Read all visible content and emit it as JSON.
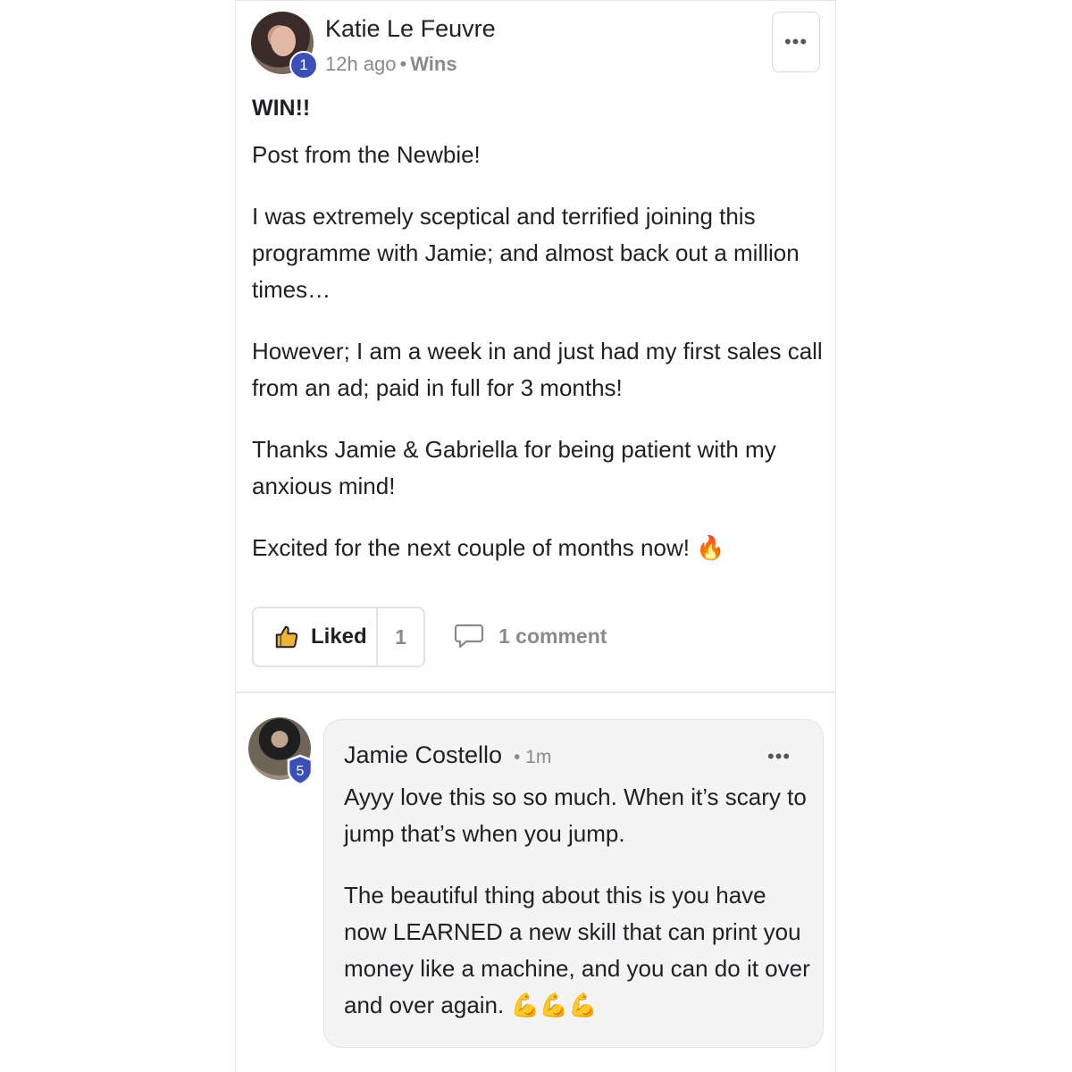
{
  "post": {
    "author": "Katie Le Feuvre",
    "level": "1",
    "time": "12h ago",
    "separator": "•",
    "category": "Wins",
    "more": "•••",
    "title": "WIN!!",
    "paragraphs": [
      "Post from the Newbie!",
      "I was extremely sceptical and terrified joining this programme with Jamie; and almost back out a million times…",
      "However; I am a week in and just had my first sales call from an ad; paid in full for 3 months!",
      "Thanks Jamie & Gabriella for being patient with my anxious mind!",
      "Excited for the next couple of months now!"
    ],
    "last_emoji": "🔥",
    "like_label": "Liked",
    "like_count": "1",
    "comment_label": "1 comment"
  },
  "comment": {
    "author": "Jamie Costello",
    "level": "5",
    "time": "• 1m",
    "more": "•••",
    "paragraphs": [
      "Ayyy love this so so much. When it’s scary to jump that’s when you jump.",
      "The beautiful thing about this is you have now LEARNED a new skill that can print you money like a machine, and you can do it over and over again."
    ],
    "last_emoji": "💪💪💪"
  },
  "colors": {
    "badge_blue": "#3b4fb8",
    "muted": "#8a8a8a",
    "like_icon": "#f2b233"
  },
  "icons": {
    "like": "thumbs-up-icon",
    "comment": "speech-bubble-icon",
    "more": "ellipsis-icon"
  }
}
